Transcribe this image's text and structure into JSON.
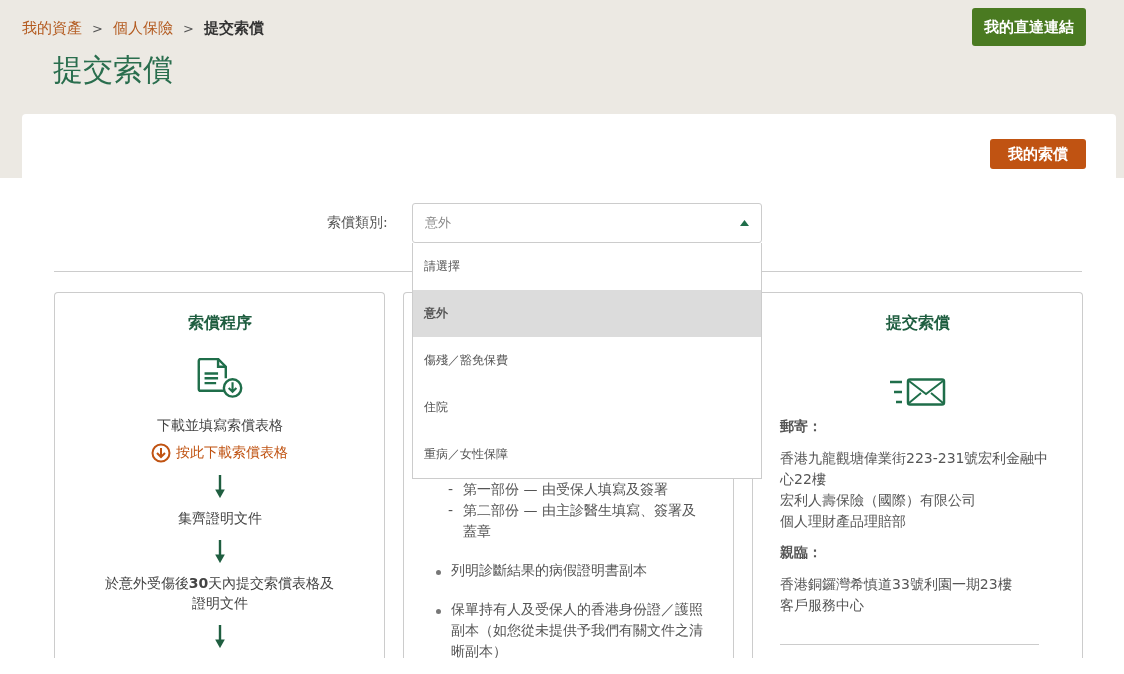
{
  "breadcrumb": [
    {
      "label": "我的資產",
      "current": false
    },
    {
      "label": "個人保險",
      "current": false
    },
    {
      "label": "提交索償",
      "current": true
    }
  ],
  "breadcrumb_separator": ">",
  "page_title": "提交索償",
  "quick_links_button": "我的直達連結",
  "my_claims_button": "我的索償",
  "claim_type": {
    "label": "索償類別:",
    "value": "意外",
    "expanded": true,
    "options": [
      {
        "label": "請選擇",
        "selected": false
      },
      {
        "label": "意外",
        "selected": true
      },
      {
        "label": "傷殘／豁免保費",
        "selected": false
      },
      {
        "label": "住院",
        "selected": false
      },
      {
        "label": "重病／女性保障",
        "selected": false
      }
    ]
  },
  "procedure": {
    "title": "索償程序",
    "steps": [
      {
        "text": "下載並填寫索償表格",
        "link": "按此下載索償表格"
      },
      {
        "text": "集齊證明文件"
      },
      {
        "text": "於意外受傷後**30**天內提交索償表格及證明文件"
      }
    ]
  },
  "documents": {
    "items": [
      {
        "kind": "sub",
        "marker": "-",
        "text": "第一部份 — 由受保人填寫及簽署"
      },
      {
        "kind": "sub",
        "marker": "-",
        "text": "第二部份 — 由主診醫生填寫、簽署及蓋章"
      },
      {
        "kind": "bullet",
        "text": "列明診斷結果的病假證明書副本"
      },
      {
        "kind": "bullet",
        "text": "保單持有人及受保人的香港身份證／護照副本（如您從未提供予我們有關文件之清晰副本）"
      }
    ]
  },
  "submit": {
    "title": "提交索償",
    "sections": [
      {
        "heading": "郵寄：",
        "lines": [
          "香港九龍觀塘偉業街223-231號宏利金融中心22樓",
          "宏利人壽保險（國際）有限公司",
          "個人理財產品理賠部"
        ]
      },
      {
        "heading": "親臨：",
        "lines": [
          "香港銅鑼灣希慎道33號利園一期23樓",
          "客戶服務中心"
        ]
      }
    ]
  }
}
